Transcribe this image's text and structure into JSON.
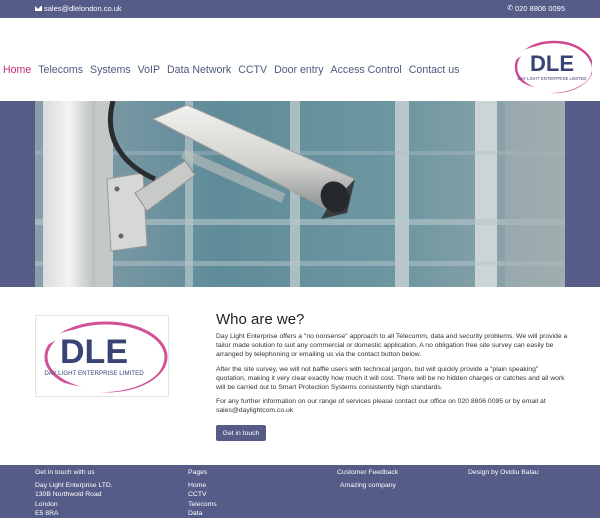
{
  "topbar": {
    "email": "sales@dlelondon.co.uk",
    "phone": "020 8806 0095",
    "email_icon": "envelope-icon",
    "phone_icon": "phone-icon"
  },
  "nav": {
    "items": [
      {
        "label": "Home",
        "active": true
      },
      {
        "label": "Telecoms",
        "active": false
      },
      {
        "label": "Systems",
        "active": false
      },
      {
        "label": "VoIP",
        "active": false
      },
      {
        "label": "Data Network",
        "active": false
      },
      {
        "label": "CCTV",
        "active": false
      },
      {
        "label": "Door entry",
        "active": false
      },
      {
        "label": "Access Control",
        "active": false
      },
      {
        "label": "Contact us",
        "active": false
      }
    ]
  },
  "logo": {
    "mark": "DLE",
    "tagline": "DAY LIGHT ENTERPRISE LIMITED"
  },
  "about": {
    "title": "Who are we?",
    "p1": "Day Light Enterprise offers a \"no nonsense\" approach to all Telecomm, data and security problems. We will provide a tailor made solution to suit any commercial or domestic application. A no obligation free site survey can easily be arranged by telephoning or emailing us via the contact button below.",
    "p2": "After the site survey, we will not baffle users with technical jargon, but will quickly provide a \"plain speaking\" quotation, making it very clear exactly how much it will cost. There will be no hidden charges or catches and all work will be carried out to Smart Protection Systems consistently high standards.",
    "p3": "For any further information on our range of services please contact our office on 020 8806 0095 or by email at sales@daylightcom.co.uk",
    "button": "Get in touch"
  },
  "footer": {
    "contact": {
      "heading": "Get in touch with us",
      "lines": [
        "Day Light Enterprise LTD.",
        "130B Northwold Road",
        "London",
        "E5 8RA"
      ]
    },
    "pages": {
      "heading": "Pages",
      "lines": [
        "Home",
        "CCTV",
        "Telecoms",
        "Data"
      ]
    },
    "feedback": {
      "heading": "Customer Feedback",
      "lines": [
        "Amazing company"
      ]
    },
    "credit": {
      "heading": "Design by Ovidiu Balau"
    }
  },
  "colors": {
    "brand": "#565c88",
    "accent": "#c6287c",
    "nav_text": "#4d5a7e"
  }
}
